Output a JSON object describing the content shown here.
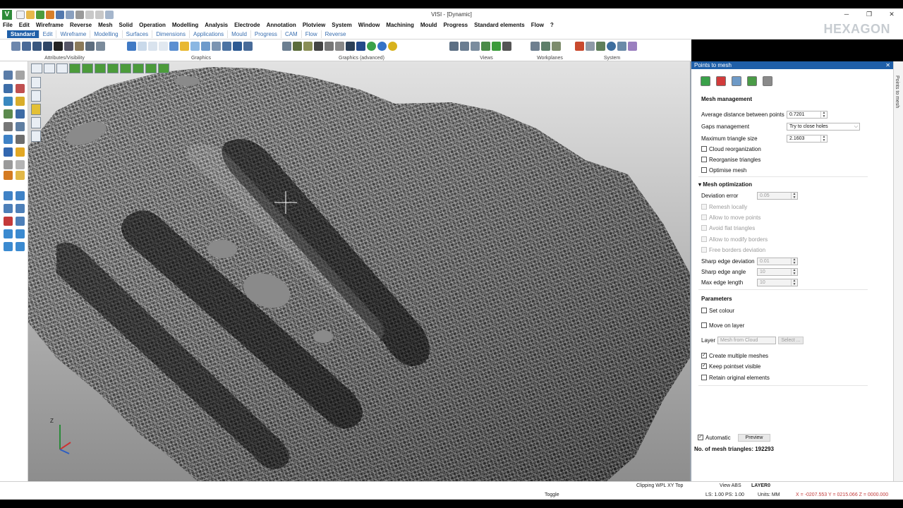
{
  "app": {
    "logo_letter": "V",
    "window_title": "VISI - [Dynamic]",
    "brand": "HEXAGON"
  },
  "window_controls": {
    "minimize": "─",
    "maximize": "❐",
    "close": "✕"
  },
  "menu": [
    "File",
    "Edit",
    "Wireframe",
    "Reverse",
    "Mesh",
    "Solid",
    "Operation",
    "Modelling",
    "Analysis",
    "Electrode",
    "Annotation",
    "Plotview",
    "System",
    "Window",
    "Machining",
    "Mould",
    "Progress",
    "Standard elements",
    "Flow",
    "?"
  ],
  "ribbon_tabs": [
    "Standard",
    "Edit",
    "Wireframe",
    "Modelling",
    "Surfaces",
    "Dimensions",
    "Applications",
    "Mould",
    "Progress",
    "CAM",
    "Flow",
    "Reverse"
  ],
  "ribbon_groups": [
    "Attributes/Visibility",
    "Graphics",
    "Graphics (advanced)",
    "Views",
    "Workplanes",
    "System"
  ],
  "panel": {
    "title": "Points to mesh",
    "pin": "✕",
    "side_tab": "Points to mesh",
    "mesh_management": {
      "title": "Mesh management",
      "avg_distance_label": "Average distance between points",
      "avg_distance_value": "0.7201",
      "gaps_label": "Gaps management",
      "gaps_value": "Try to close holes",
      "max_triangle_label": "Maximum triangle size",
      "max_triangle_value": "2.1603",
      "cloud_reorg": "Cloud reorganization",
      "reorganise": "Reorganise triangles",
      "optimise": "Optimise mesh"
    },
    "mesh_optimization": {
      "title": "Mesh optimization",
      "deviation_label": "Deviation error",
      "deviation_value": "0.05",
      "remesh": "Remesh locally",
      "move_points": "Allow to move points",
      "avoid_flat": "Avoid flat triangles",
      "modify_borders": "Allow to modify borders",
      "free_borders": "Free borders deviation",
      "sharp_dev_label": "Sharp edge deviation",
      "sharp_dev_value": "0.01",
      "sharp_angle_label": "Sharp edge angle",
      "sharp_angle_value": "10",
      "max_edge_label": "Max edge length",
      "max_edge_value": "10"
    },
    "parameters": {
      "title": "Parameters",
      "set_colour": "Set colour",
      "move_on_layer": "Move on layer",
      "layer_label": "Layer",
      "layer_value": "Mesh from Cloud",
      "select_button": "Select ...",
      "create_multiple": "Create multiple meshes",
      "keep_pointset": "Keep pointset visible",
      "retain_original": "Retain original elements"
    },
    "automatic": "Automatic",
    "preview": "Preview",
    "triangles_text": "No. of mesh triangles: 192293"
  },
  "status": {
    "toggle": "Toggle",
    "clipping": "Clipping WPL XY Top",
    "view": "View ABS",
    "layer": "LAYER0",
    "ls_ps": "LS: 1.00 PS: 1.00",
    "units": "Units: MM",
    "coords": "X = -0207.553 Y = 0215.066 Z = 0000.000"
  },
  "axis": {
    "z": "Z"
  }
}
